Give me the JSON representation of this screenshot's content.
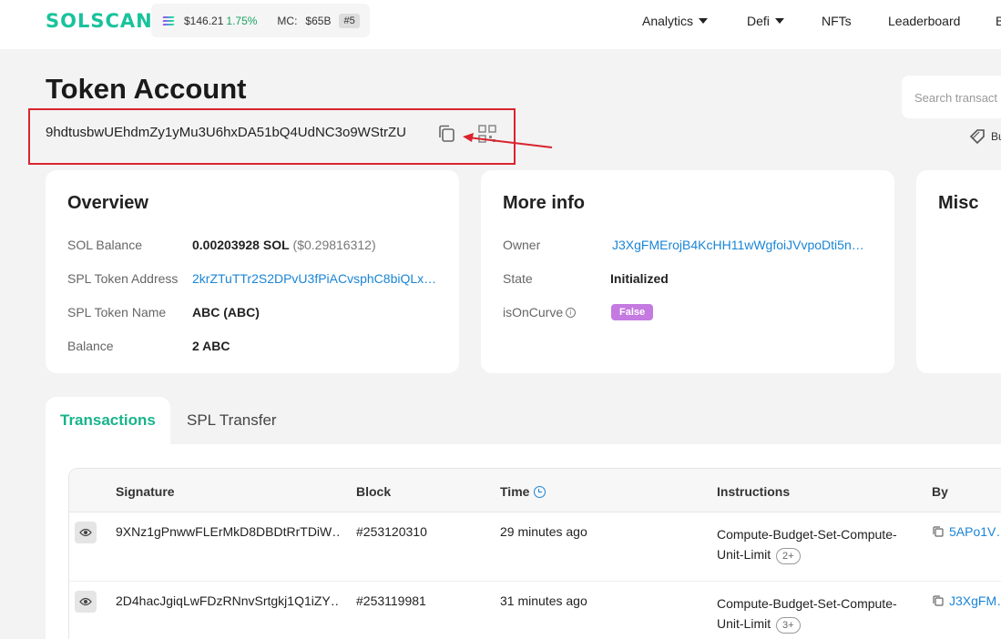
{
  "header": {
    "logo": "SOLSCAN",
    "price": "$146.21",
    "price_change": "1.75%",
    "mc_label": "MC:",
    "mc_value": "$65B",
    "rank": "#5",
    "nav": [
      {
        "label": "Analytics",
        "dropdown": true
      },
      {
        "label": "Defi",
        "dropdown": true
      },
      {
        "label": "NFTs",
        "dropdown": false
      },
      {
        "label": "Leaderboard",
        "dropdown": false
      },
      {
        "label": "B",
        "dropdown": false
      }
    ]
  },
  "page": {
    "title": "Token Account",
    "address": "9hdtusbwUEhdmZy1yMu3U6hxDA51bQ4UdNC3o9WStrZU",
    "search_placeholder": "Search transact",
    "buy_label": "Bu"
  },
  "overview": {
    "title": "Overview",
    "rows": [
      {
        "label": "SOL Balance",
        "value": "0.00203928 SOL",
        "sub": "($0.29816312)"
      },
      {
        "label": "SPL Token Address",
        "value": "2krZTuTTr2S2DPvU3fPiACvsphC8biQLxy…"
      },
      {
        "label": "SPL Token Name",
        "value": "ABC (ABC)"
      },
      {
        "label": "Balance",
        "value": "2 ABC"
      }
    ]
  },
  "more_info": {
    "title": "More info",
    "owner_label": "Owner",
    "owner_value": "J3XgFMErojB4KcHH11wWgfoiJVvpoDti5n…",
    "state_label": "State",
    "state_value": "Initialized",
    "curve_label": "isOnCurve",
    "curve_info": "i",
    "curve_value": "False"
  },
  "misc": {
    "title": "Misc"
  },
  "tabs": {
    "active": "Transactions",
    "other": "SPL Transfer"
  },
  "table": {
    "headers": {
      "signature": "Signature",
      "block": "Block",
      "time": "Time",
      "instructions": "Instructions",
      "by": "By"
    },
    "rows": [
      {
        "signature": "9XNz1gPnwwFLErMkD8DBDtRrTDiW…",
        "block": "#253120310",
        "time": "29 minutes ago",
        "instruction": "Compute-Budget-Set-Compute-Unit-Limit",
        "more": "2+",
        "by": "5APo1V…"
      },
      {
        "signature": "2D4hacJgiqLwFDzRNnvSrtgkj1Q1iZY…",
        "block": "#253119981",
        "time": "31 minutes ago",
        "instruction": "Compute-Budget-Set-Compute-Unit-Limit",
        "more": "3+",
        "by": "J3XgFM…"
      }
    ]
  },
  "colors": {
    "brand": "#19c39c",
    "link": "#1a85d6",
    "annotation": "#d9242f",
    "badge": "#c47ae0"
  }
}
